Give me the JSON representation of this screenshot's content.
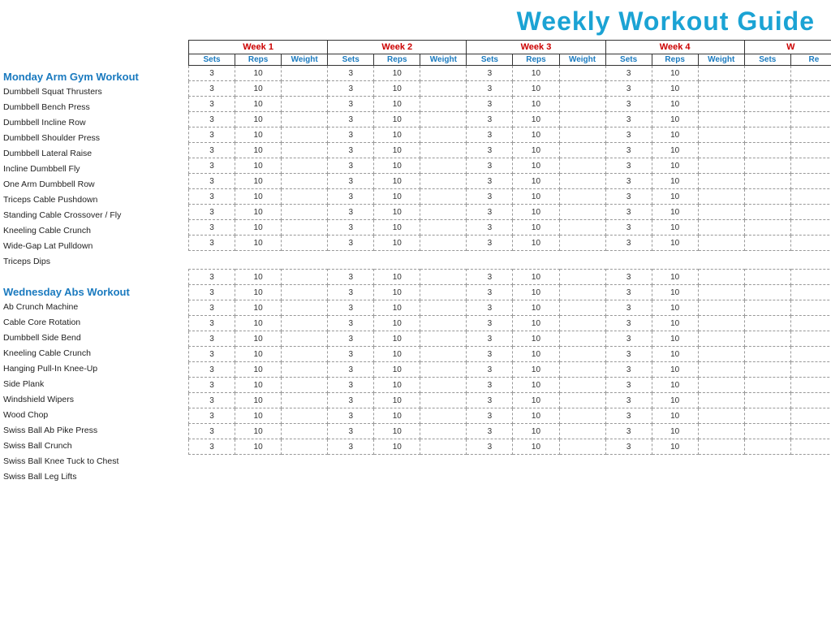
{
  "title": "Weekly Workout Guide",
  "weeks": [
    {
      "label": "Week 1"
    },
    {
      "label": "Week 2"
    },
    {
      "label": "Week 3"
    },
    {
      "label": "Week 4"
    },
    {
      "label": "W"
    }
  ],
  "col_headers": [
    "Sets",
    "Reps",
    "Weight"
  ],
  "section1": {
    "title": "Monday Arm Gym Workout",
    "exercises": [
      "Dumbbell Squat Thrusters",
      "Dumbbell Bench Press",
      "Dumbbell Incline Row",
      "Dumbbell Shoulder Press",
      "Dumbbell Lateral Raise",
      "Incline Dumbbell Fly",
      "One Arm Dumbbell Row",
      "Triceps Cable Pushdown",
      "Standing Cable Crossover / Fly",
      "Kneeling Cable Crunch",
      "Wide-Gap Lat Pulldown",
      "Triceps Dips"
    ],
    "default_sets": "3",
    "default_reps": "10"
  },
  "section2": {
    "title": "Wednesday Abs Workout",
    "exercises": [
      "Ab Crunch Machine",
      "Cable Core Rotation",
      "Dumbbell Side Bend",
      "Kneeling Cable Crunch",
      "Hanging Pull-In Knee-Up",
      "Side Plank",
      "Windshield Wipers",
      "Wood Chop",
      "Swiss Ball Ab Pike Press",
      "Swiss Ball Crunch",
      "Swiss Ball Knee Tuck to Chest",
      "Swiss Ball Leg Lifts"
    ],
    "default_sets": "3",
    "default_reps": "10"
  }
}
